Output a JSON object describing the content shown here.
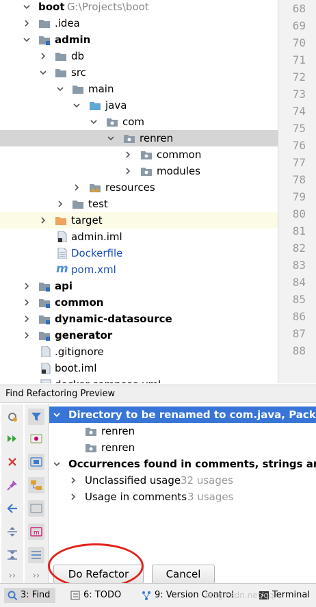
{
  "tree": {
    "rows": [
      {
        "label": "boot",
        "extra": "G:\\Projects\\boot",
        "bold": true
      },
      {
        "label": ".idea"
      },
      {
        "label": "admin",
        "bold": true
      },
      {
        "label": "db"
      },
      {
        "label": "src"
      },
      {
        "label": "main"
      },
      {
        "label": "java"
      },
      {
        "label": "com"
      },
      {
        "label": "renren"
      },
      {
        "label": "common"
      },
      {
        "label": "modules"
      },
      {
        "label": "resources"
      },
      {
        "label": "test"
      },
      {
        "label": "target"
      },
      {
        "label": "admin.iml"
      },
      {
        "label": "Dockerfile"
      },
      {
        "label": "pom.xml"
      },
      {
        "label": "api",
        "bold": true
      },
      {
        "label": "common",
        "bold": true
      },
      {
        "label": "dynamic-datasource",
        "bold": true
      },
      {
        "label": "generator",
        "bold": true
      },
      {
        "label": ".gitignore"
      },
      {
        "label": "boot.iml"
      },
      {
        "label": "docker-compose.yml"
      }
    ]
  },
  "gutter": {
    "lines": [
      "68",
      "69",
      "70",
      "71",
      "72",
      "73",
      "74",
      "75",
      "76",
      "77",
      "78",
      "79",
      "80",
      "81",
      "82",
      "83",
      "84",
      "85",
      "86",
      "87",
      "88"
    ]
  },
  "panel": {
    "title": "Find Refactoring Preview",
    "results": [
      {
        "label": "Directory to be renamed to com.java, Package to"
      },
      {
        "label": "renren"
      },
      {
        "label": "renren"
      },
      {
        "label": "Occurrences found in comments, strings and non"
      },
      {
        "label": "Unclassified usage",
        "count": "32 usages"
      },
      {
        "label": "Usage in comments",
        "count": "3 usages"
      }
    ],
    "do_refactor": "Do Refactor",
    "cancel": "Cancel"
  },
  "statusbar": {
    "find": "3: Find",
    "todo": "6: TODO",
    "vcs": "9: Version Control",
    "terminal": "Terminal",
    "watermark": "blog.csdn.net/qq"
  },
  "colors": {
    "selection": "#3875d7",
    "folder": "#8b9aa8",
    "target_folder": "#f0a35e",
    "annotation_red": "#e2231a"
  }
}
